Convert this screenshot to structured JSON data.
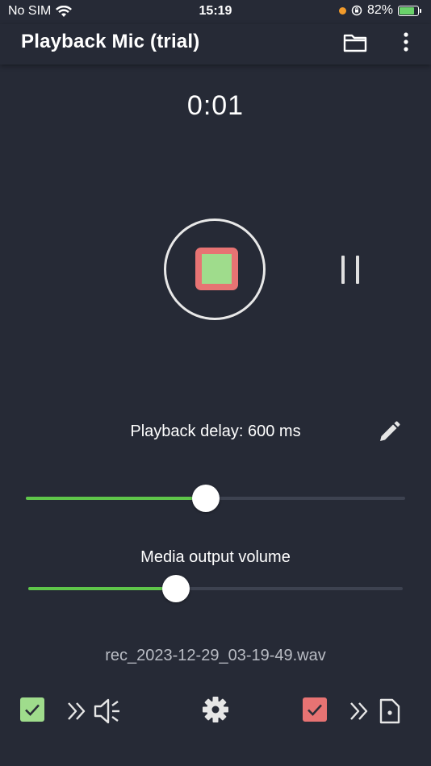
{
  "status_bar": {
    "carrier": "No SIM",
    "time": "15:19",
    "battery_percent": "82%",
    "battery_level": 0.82
  },
  "app_bar": {
    "title": "Playback Mic (trial)"
  },
  "recorder": {
    "timer": "0:01"
  },
  "delay": {
    "label": "Playback delay: 600 ms",
    "slider_fraction": 0.475
  },
  "volume": {
    "label": "Media output volume",
    "slider_fraction": 0.395
  },
  "file": {
    "name": "rec_2023-12-29_03-19-49.wav"
  },
  "bottom_bar": {
    "speaker_output_checked": true,
    "file_output_checked": true
  },
  "colors": {
    "background": "#262a36",
    "accent_green": "#5fc64a",
    "checkbox_green": "#9fdc8c",
    "checkbox_red": "#e77373",
    "track": "#3d4250"
  }
}
